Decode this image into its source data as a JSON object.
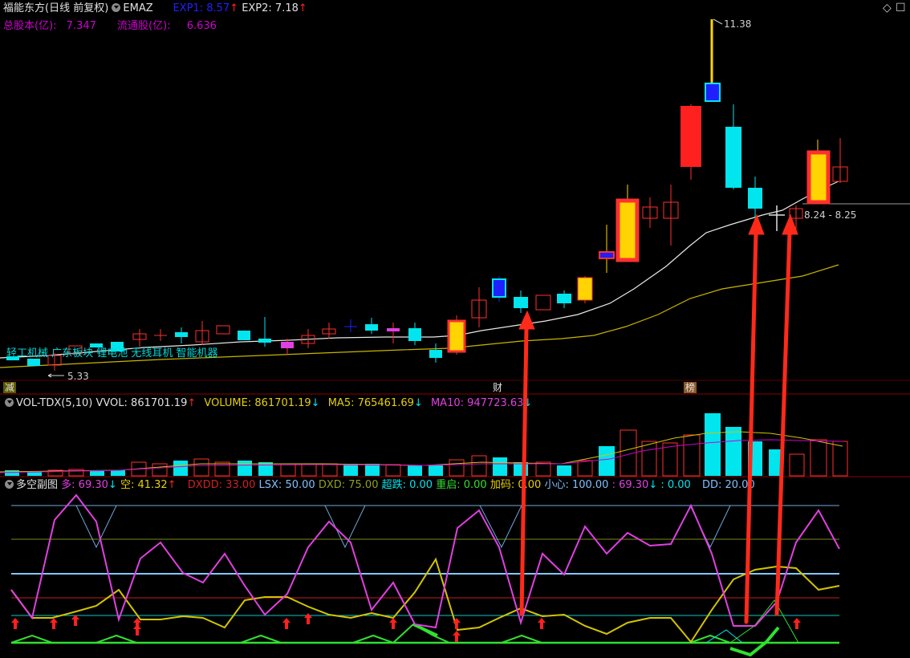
{
  "header": {
    "stock_title": "福能东方(日线 前复权)",
    "indicator": "EMAZ",
    "exp1_label": "EXP1: 8.57",
    "exp2_label": "EXP2: 7.18",
    "total_shares_label": "总股本(亿):",
    "total_shares_value": "7.347",
    "float_shares_label": "流通股(亿):",
    "float_shares_value": "6.636"
  },
  "price_chart": {
    "high_label": "11.38",
    "low_label": "5.33",
    "cursor_price": "8.24 - 8.25",
    "sector_tags": "轻工机械 广东板块 锂电池 无线耳机 智能机器",
    "event_markers": [
      "减",
      "财",
      "榜"
    ],
    "colors": {
      "up": "#ff3030",
      "down": "#00e5ee",
      "ma1": "#e8e8e8",
      "ma2": "#d4c400"
    }
  },
  "volume_panel": {
    "name": "VOL-TDX(5,10)",
    "vvol": "VVOL: 861701.19",
    "volume": "VOLUME: 861701.19",
    "ma5": "MA5: 765461.69",
    "ma10": "MA10: 947723.63"
  },
  "sub_panel": {
    "name": "多空副图",
    "duo": "多: 69.30",
    "kong": "空: 41.32",
    "dxdd": "DXDD: 33.00",
    "lsx": "LSX: 50.00",
    "dxd": "DXD: 75.00",
    "chaodie": "超跌: 0.00",
    "chongqi": "重启: 0.00",
    "jiama": "加码: 0.00",
    "xiaoxin": "小心: 100.00",
    "v1": ": 69.30",
    "v2": ": 0.00",
    "dd": "DD: 20.00"
  },
  "toolbar": {
    "diamond": "◇",
    "window": "☐"
  }
}
